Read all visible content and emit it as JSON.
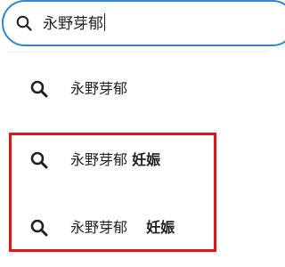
{
  "search": {
    "query": "永野芽郁",
    "icon": "search-icon",
    "accent_color": "#2f86d1"
  },
  "suggestions": [
    {
      "icon": "search-icon",
      "text": "永野芽郁",
      "bold": ""
    },
    {
      "icon": "search-icon",
      "text": "永野芽郁 ",
      "bold": "妊娠"
    },
    {
      "icon": "search-icon",
      "text": "永野芽郁　 ",
      "bold": "妊娠"
    }
  ],
  "highlight_color": "#e0131a"
}
